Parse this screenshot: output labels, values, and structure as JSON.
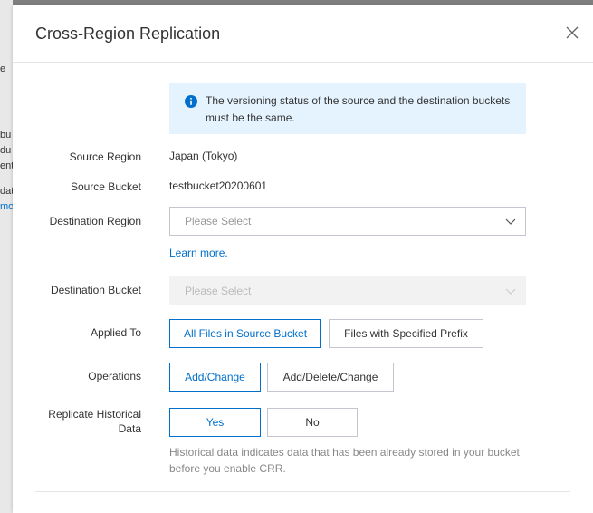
{
  "background_fragments": [
    "e",
    "bu",
    "du",
    "ent",
    "dat",
    "mo"
  ],
  "modal": {
    "title": "Cross-Region Replication",
    "notice": "The versioning status of the source and the destination buckets must be the same."
  },
  "form": {
    "source_region": {
      "label": "Source Region",
      "value": "Japan (Tokyo)"
    },
    "source_bucket": {
      "label": "Source Bucket",
      "value": "testbucket20200601"
    },
    "destination_region": {
      "label": "Destination Region",
      "placeholder": "Please Select",
      "learn_more": "Learn more."
    },
    "destination_bucket": {
      "label": "Destination Bucket",
      "placeholder": "Please Select"
    },
    "applied_to": {
      "label": "Applied To",
      "options": [
        "All Files in Source Bucket",
        "Files with Specified Prefix"
      ],
      "selected": "All Files in Source Bucket"
    },
    "operations": {
      "label": "Operations",
      "options": [
        "Add/Change",
        "Add/Delete/Change"
      ],
      "selected": "Add/Change"
    },
    "replicate_historical": {
      "label_line1": "Replicate Historical",
      "label_line2": "Data",
      "options": [
        "Yes",
        "No"
      ],
      "selected": "Yes",
      "hint": "Historical data indicates data that has been already stored in your bucket before you enable CRR."
    }
  },
  "colors": {
    "accent": "#0070cc",
    "notice_bg": "#e5f3ff",
    "overlay": "#7f7f7f"
  }
}
